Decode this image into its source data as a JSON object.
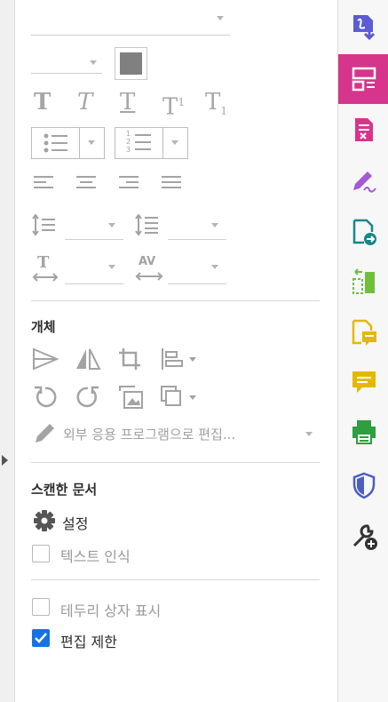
{
  "object_section": {
    "title": "개체",
    "edit_external_label": "외부 응용 프로그램으로 편집..."
  },
  "scanned_section": {
    "title": "스캔한 문서",
    "settings_label": "설정",
    "ocr_label": "텍스트 인식",
    "ocr_checked": false
  },
  "options": {
    "bounding_box_label": "테두리 상자 표시",
    "bounding_box_checked": false,
    "restrict_edit_label": "편집 제한",
    "restrict_edit_checked": true
  },
  "formatting": {
    "text_styles": [
      "T",
      "T",
      "T",
      "T",
      "T"
    ],
    "list_numbers": [
      "1",
      "2",
      "3"
    ],
    "char_spacing_abbr": "AV"
  },
  "colors": {
    "active_rail": "#d6358c",
    "checkbox_checked": "#1473e6",
    "font_color_swatch": "#808080"
  },
  "rail_icons": [
    "export-pdf-icon",
    "edit-pdf-icon",
    "fill-sign-form-icon",
    "sign-icon",
    "share-pdf-icon",
    "organize-pages-icon",
    "comment-doc-icon",
    "comment-icon",
    "print-production-icon",
    "protect-icon",
    "more-tools-icon"
  ]
}
